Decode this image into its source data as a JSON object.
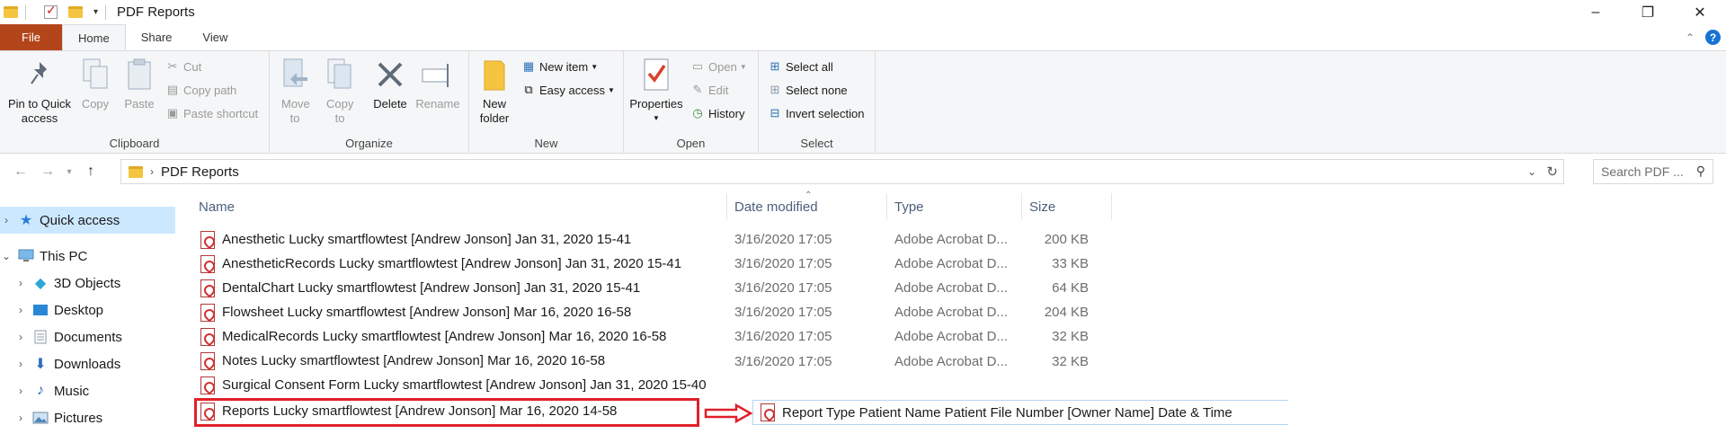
{
  "window": {
    "title": "PDF Reports",
    "controls": [
      "–",
      "❐",
      "✕"
    ]
  },
  "ribbon_tabs": [
    "File",
    "Home",
    "Share",
    "View"
  ],
  "ribbon": {
    "clipboard": {
      "label": "Clipboard",
      "pin": "Pin to Quick access",
      "copy": "Copy",
      "paste": "Paste",
      "cut": "Cut",
      "copy_path": "Copy path",
      "paste_shortcut": "Paste shortcut"
    },
    "organize": {
      "label": "Organize",
      "move_to": "Move to",
      "copy_to": "Copy to",
      "delete": "Delete",
      "rename": "Rename"
    },
    "new": {
      "label": "New",
      "new_folder": "New folder",
      "new_item": "New item",
      "easy_access": "Easy access"
    },
    "open": {
      "label": "Open",
      "properties": "Properties",
      "open": "Open",
      "edit": "Edit",
      "history": "History"
    },
    "select": {
      "label": "Select",
      "select_all": "Select all",
      "select_none": "Select none",
      "invert_selection": "Invert selection"
    }
  },
  "address": {
    "path": "PDF Reports",
    "search_placeholder": "Search PDF ..."
  },
  "nav_pane": {
    "quick_access": "Quick access",
    "this_pc": "This PC",
    "items": [
      "3D Objects",
      "Desktop",
      "Documents",
      "Downloads",
      "Music",
      "Pictures"
    ]
  },
  "columns": {
    "name": "Name",
    "date": "Date modified",
    "type": "Type",
    "size": "Size"
  },
  "files": [
    {
      "name": "Anesthetic Lucky smartflowtest [Andrew Jonson] Jan 31, 2020 15-41",
      "date": "3/16/2020 17:05",
      "type": "Adobe Acrobat D...",
      "size": "200 KB"
    },
    {
      "name": "AnestheticRecords Lucky smartflowtest [Andrew Jonson] Jan 31, 2020 15-41",
      "date": "3/16/2020 17:05",
      "type": "Adobe Acrobat D...",
      "size": "33 KB"
    },
    {
      "name": "DentalChart Lucky smartflowtest [Andrew Jonson] Jan 31, 2020 15-41",
      "date": "3/16/2020 17:05",
      "type": "Adobe Acrobat D...",
      "size": "64 KB"
    },
    {
      "name": "Flowsheet Lucky smartflowtest [Andrew Jonson] Mar 16, 2020 16-58",
      "date": "3/16/2020 17:05",
      "type": "Adobe Acrobat D...",
      "size": "204 KB"
    },
    {
      "name": "MedicalRecords Lucky smartflowtest [Andrew Jonson] Mar 16, 2020 16-58",
      "date": "3/16/2020 17:05",
      "type": "Adobe Acrobat D...",
      "size": "32 KB"
    },
    {
      "name": "Notes Lucky smartflowtest [Andrew Jonson] Mar 16, 2020 16-58",
      "date": "3/16/2020 17:05",
      "type": "Adobe Acrobat D...",
      "size": "32 KB"
    },
    {
      "name": "Surgical Consent Form Lucky smartflowtest [Andrew Jonson] Jan 31, 2020 15-40",
      "date": "",
      "type": "",
      "size": ""
    },
    {
      "name": "Reports Lucky smartflowtest [Andrew Jonson] Mar 16, 2020 14-58",
      "date": "",
      "type": "",
      "size": ""
    }
  ],
  "callout": {
    "text": "Report Type Patient Name Patient File Number [Owner Name] Date & Time"
  },
  "colors": {
    "file_tab": "#b4451b",
    "selection": "#cce8ff",
    "highlight_red": "#e0202a"
  }
}
